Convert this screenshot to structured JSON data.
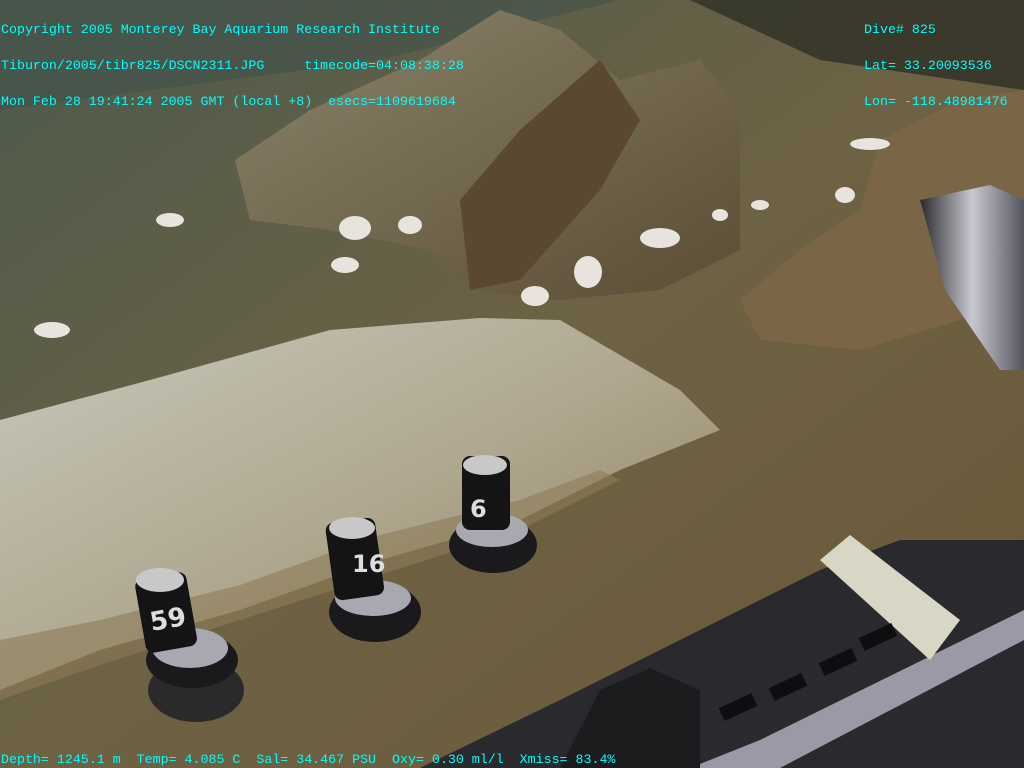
{
  "overlay": {
    "top_left": [
      "Copyright 2005 Monterey Bay Aquarium Research Institute",
      "Tiburon/2005/tibr825/DSCN2311.JPG     timecode=04:08:38:28",
      "Mon Feb 28 19:41:24 2005 GMT (local +8)  esecs=1109619684"
    ],
    "top_right": [
      "Dive# 825",
      "Lat= 33.20093536",
      "Lon= -118.48981476"
    ],
    "bottom": "Depth= 1245.1 m  Temp= 4.085 C  Sal= 34.467 PSU  Oxy= 0.30 ml/l  Xmiss= 83.4%"
  },
  "markers": [
    "59",
    "16",
    "6"
  ],
  "colors": {
    "overlay_text": "#00ffff"
  }
}
